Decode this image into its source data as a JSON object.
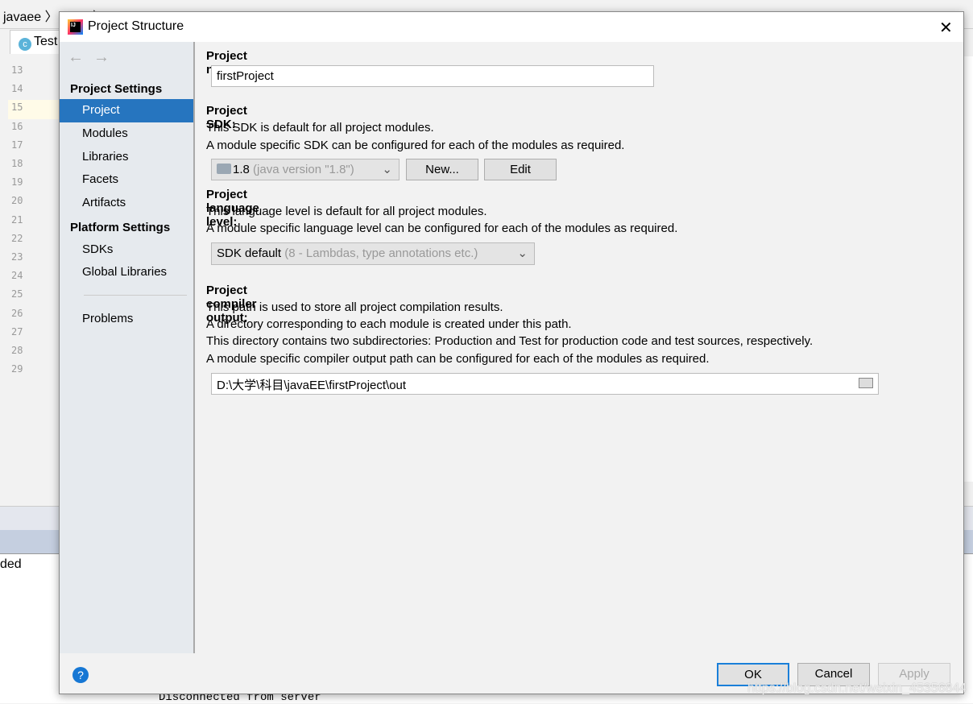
{
  "ide": {
    "breadcrumb": "javaee 〉 code 〉 TestJDBC",
    "tab": "Test",
    "line_numbers": [
      "13",
      "14",
      "15",
      "16",
      "17",
      "18",
      "19",
      "20",
      "21",
      "22",
      "23",
      "24",
      "25",
      "26",
      "27",
      "28",
      "29"
    ],
    "console_text": "ded",
    "console_line": "Disconnected from server"
  },
  "dialog": {
    "title": "Project Structure",
    "sidebar": {
      "project_settings": "Project Settings",
      "items": [
        "Project",
        "Modules",
        "Libraries",
        "Facets",
        "Artifacts"
      ],
      "platform_settings": "Platform Settings",
      "platform_items": [
        "SDKs",
        "Global Libraries"
      ],
      "problems": "Problems",
      "selected": "Project"
    },
    "project_name": {
      "label": "Project name:",
      "value": "firstProject"
    },
    "sdk": {
      "label": "Project SDK:",
      "desc1": "This SDK is default for all project modules.",
      "desc2": "A module specific SDK can be configured for each of the modules as required.",
      "value": "1.8",
      "value_hint": "(java version \"1.8\")",
      "new_label": "New...",
      "edit_label": "Edit"
    },
    "language": {
      "label": "Project language level:",
      "desc1": "This language level is default for all project modules.",
      "desc2": "A module specific language level can be configured for each of the modules as required.",
      "value": "SDK default",
      "value_hint": "(8 - Lambdas, type annotations etc.)"
    },
    "output": {
      "label": "Project compiler output:",
      "desc1": "This path is used to store all project compilation results.",
      "desc2": "A directory corresponding to each module is created under this path.",
      "desc3": "This directory contains two subdirectories: Production and Test for production code and test sources, respectively.",
      "desc4": "A module specific compiler output path can be configured for each of the modules as required.",
      "value": "D:\\大学\\科目\\javaEE\\firstProject\\out"
    },
    "buttons": {
      "ok": "OK",
      "cancel": "Cancel",
      "apply": "Apply"
    }
  },
  "watermark": "https://blog.csdn.net/weixin_45356844",
  "colors": {
    "selection": "#2675bf",
    "help": "#1677d4"
  }
}
